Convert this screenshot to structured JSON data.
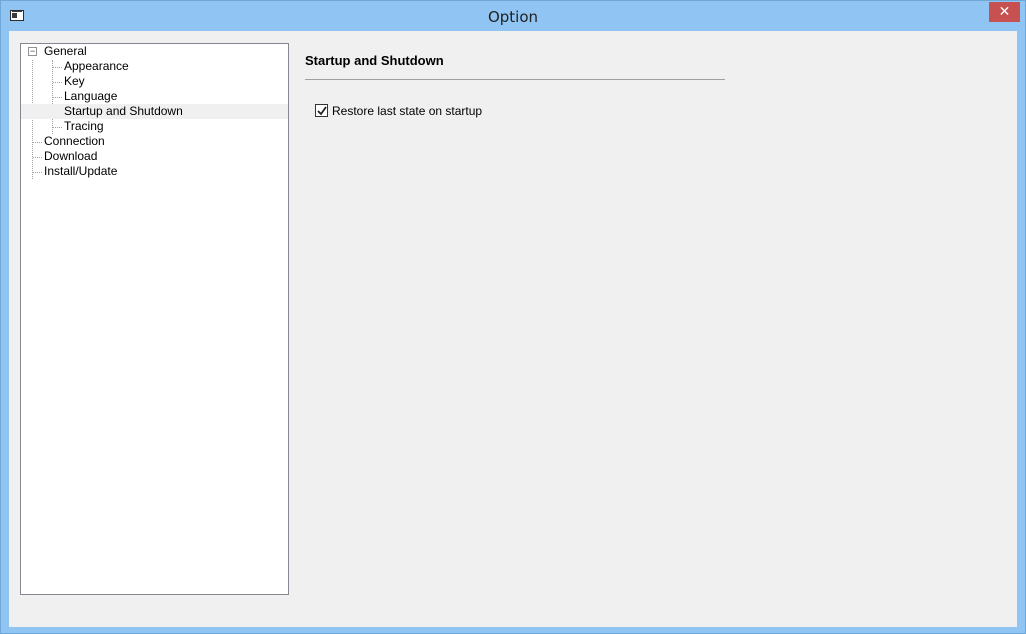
{
  "window": {
    "title": "Option",
    "close_glyph": "✕",
    "app_icon": "window-icon"
  },
  "tree": {
    "expander_glyph": "−",
    "items": [
      {
        "label": "General",
        "level": 0,
        "expanded": true
      },
      {
        "label": "Appearance",
        "level": 1
      },
      {
        "label": "Key",
        "level": 1
      },
      {
        "label": "Language",
        "level": 1
      },
      {
        "label": "Startup and Shutdown",
        "level": 1,
        "selected": true
      },
      {
        "label": "Tracing",
        "level": 1
      },
      {
        "label": "Connection",
        "level": 0
      },
      {
        "label": "Download",
        "level": 0
      },
      {
        "label": "Install/Update",
        "level": 0
      }
    ]
  },
  "content": {
    "section_title": "Startup and Shutdown",
    "restore_checkbox": {
      "label": "Restore last state on startup",
      "checked": true
    }
  },
  "colors": {
    "title_bar": "#8fc4f3",
    "close_button": "#c75050",
    "client_bg": "#f0f0f0"
  }
}
